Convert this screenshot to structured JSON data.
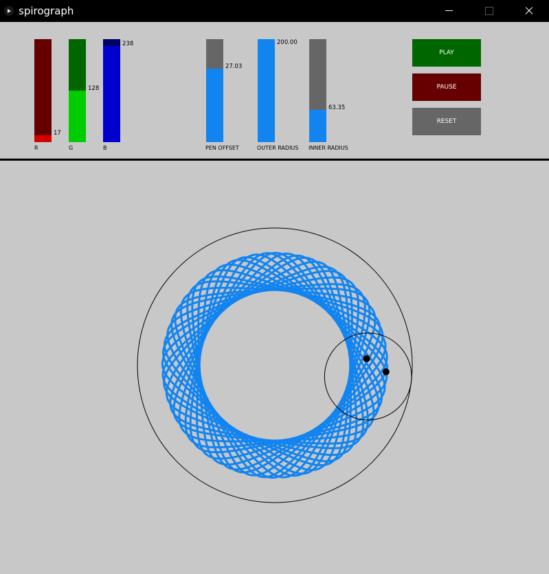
{
  "window": {
    "title": "spirograph"
  },
  "sliders": {
    "r": {
      "label": "R",
      "value": "17",
      "fraction": 0.0667,
      "track_color": "#660000",
      "fill_color": "#d40000"
    },
    "g": {
      "label": "G",
      "value": "128",
      "fraction": 0.502,
      "track_color": "#006600",
      "fill_color": "#00cc00"
    },
    "b": {
      "label": "B",
      "value": "238",
      "fraction": 0.933,
      "track_color": "#000066",
      "fill_color": "#0000cc"
    },
    "pen_offset": {
      "label": "PEN OFFSET",
      "value": "27.03",
      "fraction": 0.71,
      "track_color": "#666666",
      "fill_color": "#1284f0"
    },
    "outer_radius": {
      "label": "OUTER RADIUS",
      "value": "200.00",
      "fraction": 1.0,
      "track_color": "#666666",
      "fill_color": "#1284f0"
    },
    "inner_radius": {
      "label": "INNER RADIUS",
      "value": "63.35",
      "fraction": 0.31,
      "track_color": "#666666",
      "fill_color": "#1284f0"
    }
  },
  "buttons": {
    "play": {
      "label": "PLAY",
      "color": "#006600"
    },
    "pause": {
      "label": "PAUSE",
      "color": "#660000"
    },
    "reset": {
      "label": "RESET",
      "color": "#666666"
    }
  },
  "spirograph": {
    "outer_radius": 200,
    "inner_radius": 63.35,
    "pen_offset": 27.03,
    "pen_color": "#1284f0"
  }
}
